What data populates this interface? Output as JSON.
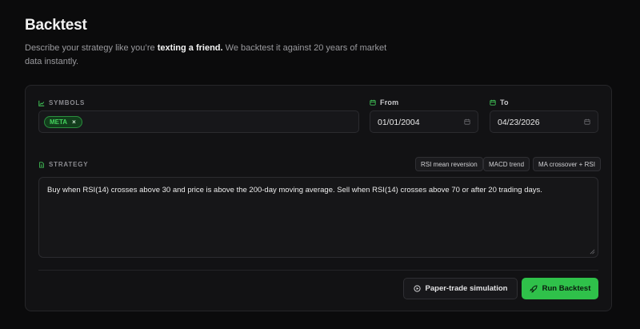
{
  "header": {
    "title": "Backtest",
    "subtitle_pre": "Describe your strategy like you’re ",
    "subtitle_bold": "texting a friend.",
    "subtitle_post": " We backtest it against 20 years of market data instantly."
  },
  "symbols": {
    "label": "SYMBOLS",
    "icon": "chart-line-icon",
    "chips": [
      {
        "label": "META",
        "remove": "×"
      }
    ]
  },
  "dates": {
    "from_label": "From",
    "from_value": "01/01/2004",
    "to_label": "To",
    "to_value": "04/23/2026",
    "icon": "calendar-icon"
  },
  "strategy": {
    "label": "STRATEGY",
    "icon": "document-icon",
    "text": "Buy when RSI(14) crosses above 30 and price is above the 200-day moving average. Sell when RSI(14) crosses above 70 or after 20 trading days.",
    "presets": [
      "RSI mean reversion",
      "MACD trend",
      "MA crossover + RSI"
    ]
  },
  "actions": {
    "paper_trade": "Paper-trade simulation",
    "run": "Run Backtest"
  },
  "colors": {
    "accent": "#2fc14a",
    "chip_bg": "#123d1c",
    "chip_text": "#44d35d",
    "background": "#0b0b0c",
    "card": "#121214"
  }
}
